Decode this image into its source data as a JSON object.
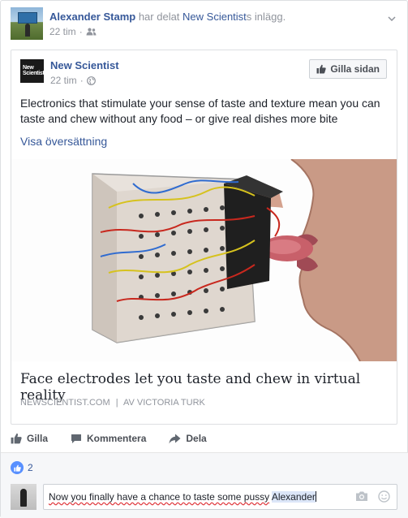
{
  "header": {
    "author": "Alexander Stamp",
    "shared_text": "har delat",
    "page_link": "New Scientist",
    "post_suffix": "s inlägg.",
    "time": "22 tim",
    "audience_icon": "friends-icon"
  },
  "shared_post": {
    "logo_text": "New Scientist",
    "page_name": "New Scientist",
    "time": "22 tim",
    "audience_icon": "globe-icon",
    "like_page_button": "Gilla sidan",
    "text": "Electronics that stimulate your sense of taste and texture mean you can taste and chew without any food – or give real dishes more bite",
    "translate_link": "Visa översättning",
    "article": {
      "title": "Face electrodes let you taste and chew in virtual reality",
      "source": "NEWSCIENTIST.COM",
      "separator": "|",
      "author": "AV VICTORIA TURK"
    }
  },
  "actions": {
    "like": "Gilla",
    "comment": "Kommentera",
    "share": "Dela"
  },
  "feedback": {
    "like_count": "2",
    "comment_draft": "Now you finally have a chance to taste some pussy",
    "mention": "Alexander"
  },
  "colors": {
    "link": "#365899",
    "like_blue": "#5890ff",
    "meta_gray": "#90949c"
  }
}
